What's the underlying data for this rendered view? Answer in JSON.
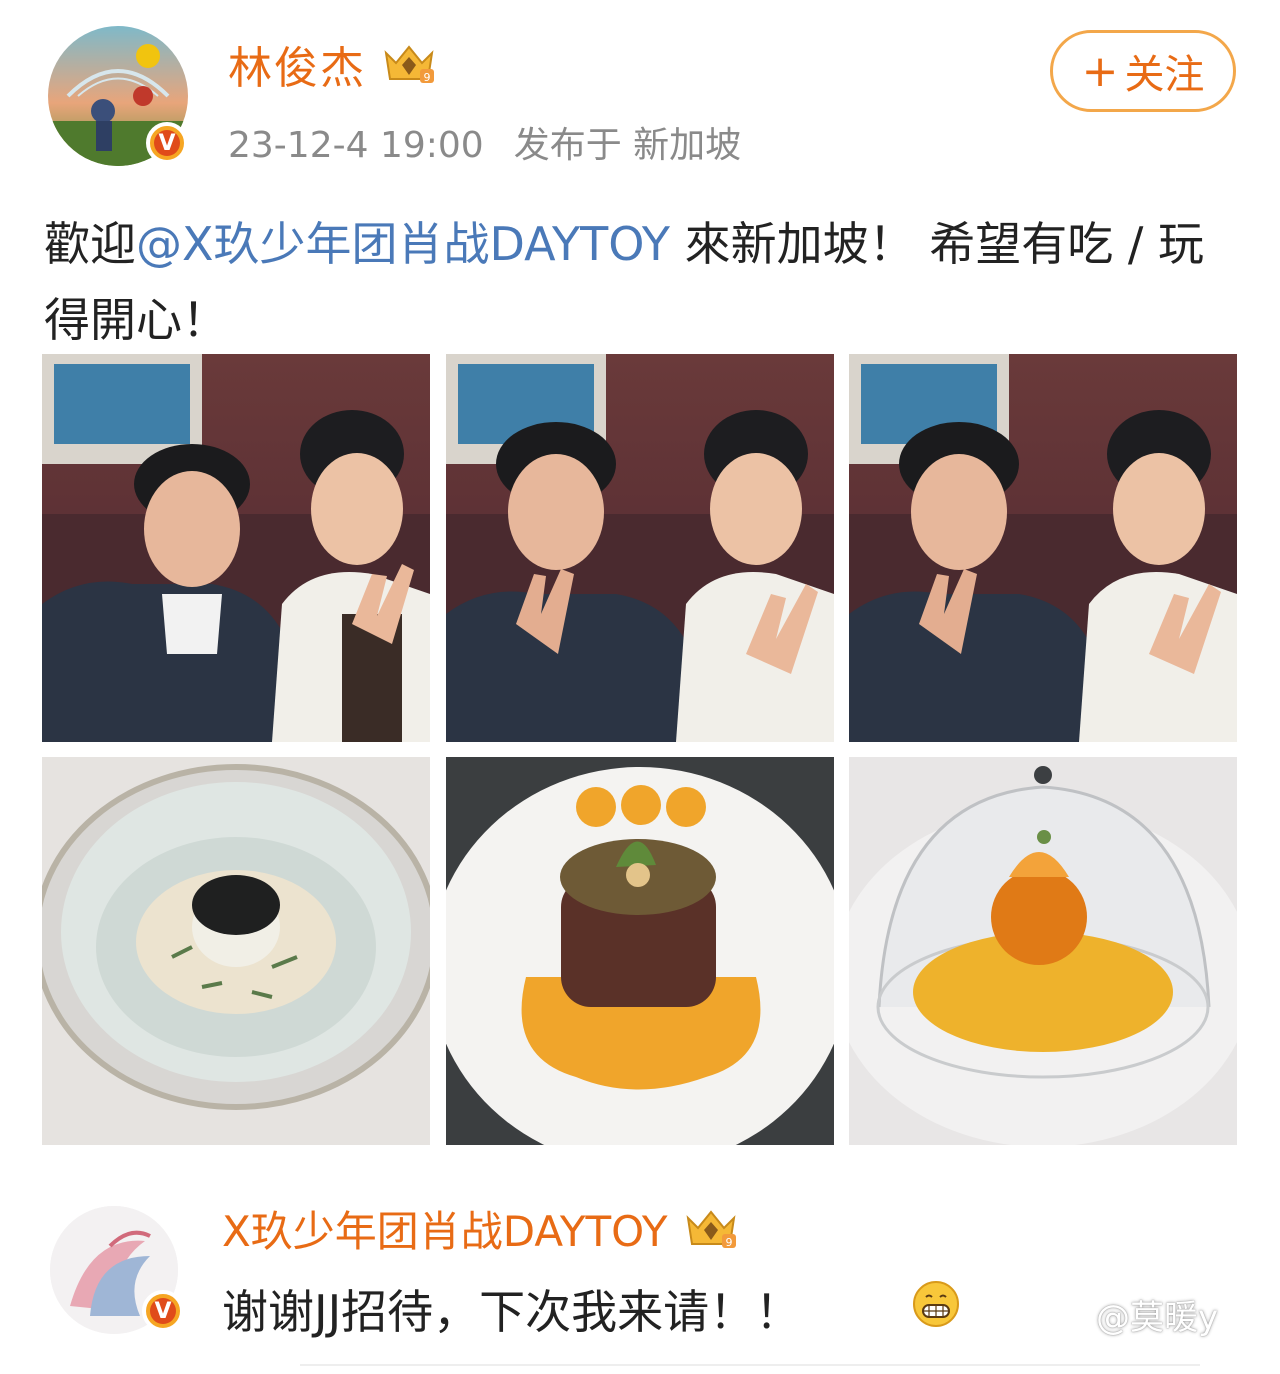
{
  "post": {
    "username": "林俊杰",
    "timestamp": "23-12-4 19:00",
    "location": "发布于 新加坡",
    "follow_label": "关注",
    "follow_plus": "+",
    "text_before": "歡迎",
    "mention": "@X玖少年团肖战DAYTOY",
    "text_after": " 來新加坡！ 希望有吃 / 玩得開心！"
  },
  "photos": [
    {
      "subject": "selfie-1"
    },
    {
      "subject": "selfie-2"
    },
    {
      "subject": "selfie-3"
    },
    {
      "subject": "caviar-dish"
    },
    {
      "subject": "steak-dish"
    },
    {
      "subject": "dessert-under-cloche"
    }
  ],
  "comment": {
    "username": "X玖少年团肖战DAYTOY",
    "text": "谢谢JJ招待，下次我来请！！",
    "emoji": "grin-emoji"
  },
  "watermark": "@莫暖y",
  "colors": {
    "brand_orange": "#e86b15",
    "mention_blue": "#4a79b8",
    "meta_gray": "#8a8a8a",
    "follow_border": "#f3a74a"
  }
}
